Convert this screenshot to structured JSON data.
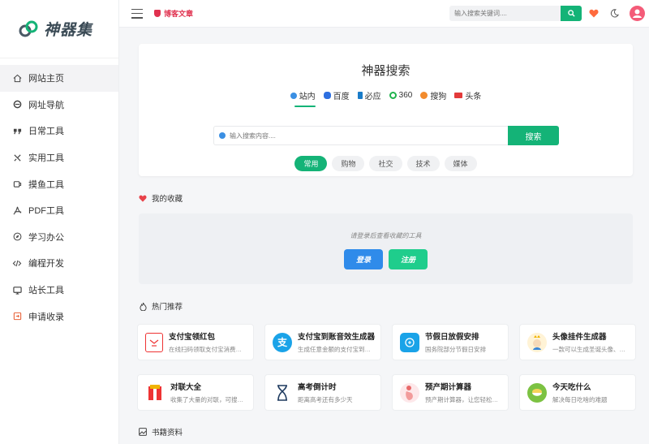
{
  "site": {
    "name": "神器集"
  },
  "sidebar": {
    "items": [
      {
        "label": "网站主页",
        "icon": "home-icon"
      },
      {
        "label": "网址导航",
        "icon": "browser-icon"
      },
      {
        "label": "日常工具",
        "icon": "quote-icon"
      },
      {
        "label": "实用工具",
        "icon": "tools-icon"
      },
      {
        "label": "摸鱼工具",
        "icon": "coffee-icon"
      },
      {
        "label": "PDF工具",
        "icon": "pdf-icon"
      },
      {
        "label": "学习办公",
        "icon": "compass-icon"
      },
      {
        "label": "编程开发",
        "icon": "code-icon"
      },
      {
        "label": "站长工具",
        "icon": "monitor-icon"
      },
      {
        "label": "申请收录",
        "icon": "submit-icon"
      }
    ]
  },
  "header": {
    "blog_link": "博客文章",
    "search_placeholder": "输入搜索关键词....",
    "accent": "#14b377"
  },
  "search": {
    "title": "神器搜索",
    "engines": [
      {
        "label": "站内"
      },
      {
        "label": "百度"
      },
      {
        "label": "必应"
      },
      {
        "label": "360"
      },
      {
        "label": "搜狗"
      },
      {
        "label": "头条"
      }
    ],
    "placeholder": "输入搜索内容....",
    "button": "搜索",
    "categories": [
      {
        "label": "常用"
      },
      {
        "label": "购物"
      },
      {
        "label": "社交"
      },
      {
        "label": "技术"
      },
      {
        "label": "媒体"
      }
    ]
  },
  "favorites": {
    "title": "我的收藏",
    "message": "请登录后查看收藏的工具",
    "login": "登录",
    "register": "注册"
  },
  "hot": {
    "title": "热门推荐",
    "tools": [
      {
        "name": "支付宝领红包",
        "desc": "在线扫码领取支付宝消费红包"
      },
      {
        "name": "支付宝到账音效生成器",
        "desc": "生成任意金额的支付宝到账音效"
      },
      {
        "name": "节假日放假安排",
        "desc": "国务院部分节假日安排"
      },
      {
        "name": "头像挂件生成器",
        "desc": "一款可以生成圣诞头像、节日头像挂件"
      },
      {
        "name": "对联大全",
        "desc": "收集了大量的对联，可搜索查询"
      },
      {
        "name": "高考倒计时",
        "desc": "距离高考还有多少天"
      },
      {
        "name": "预产期计算器",
        "desc": "预产期计算器，让您轻松计算"
      },
      {
        "name": "今天吃什么",
        "desc": "解决每日吃啥的难题"
      }
    ]
  },
  "books": {
    "title": "书籍资料"
  }
}
